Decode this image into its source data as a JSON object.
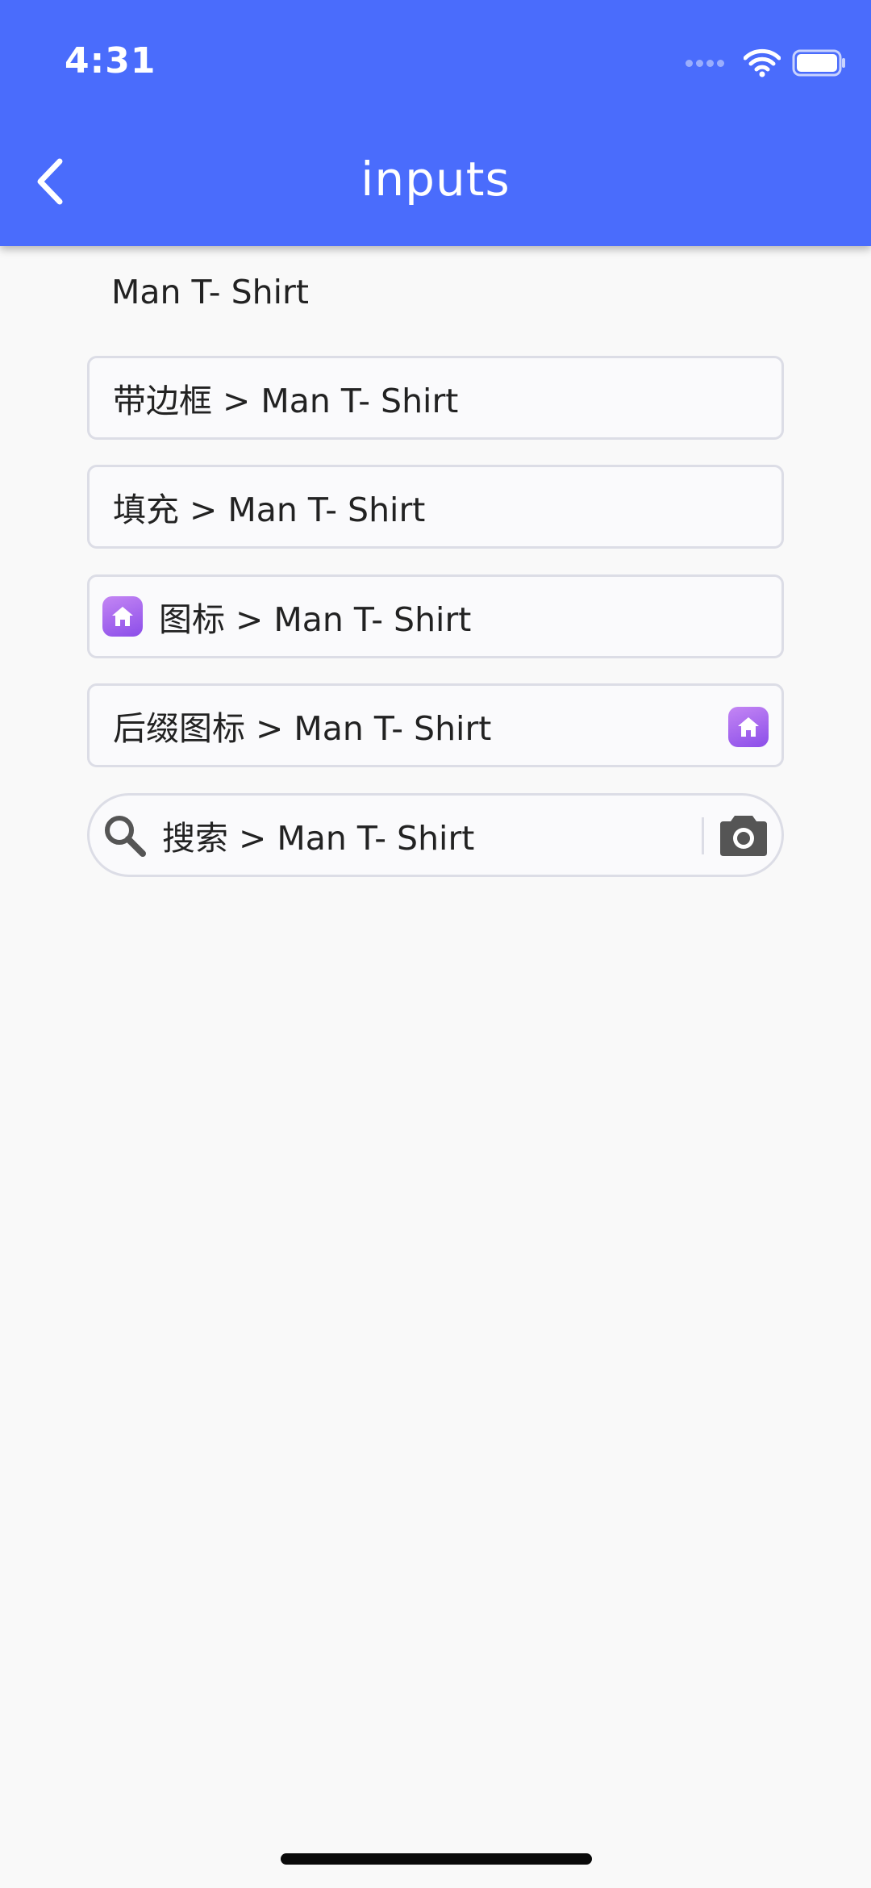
{
  "status_bar": {
    "time": "4:31"
  },
  "app_bar": {
    "title": "inputs"
  },
  "content": {
    "plain_value": "Man T- Shirt",
    "fields": [
      {
        "label": "带边框 > Man T- Shirt"
      },
      {
        "label": "填充 > Man T- Shirt"
      },
      {
        "label": "图标 > Man T- Shirt",
        "prefix_icon": "home-icon"
      },
      {
        "label": "后缀图标 > Man T- Shirt",
        "suffix_icon": "home-icon"
      },
      {
        "label": "搜索 > Man T- Shirt",
        "prefix_icon": "search-icon",
        "suffix_icon": "camera-icon"
      }
    ]
  },
  "colors": {
    "app_bar": "#4a6cfc",
    "background": "#f9f9f9",
    "field_border": "#dcdde6",
    "icon_gradient_start": "#c486f4",
    "icon_gradient_end": "#8b4de9"
  }
}
